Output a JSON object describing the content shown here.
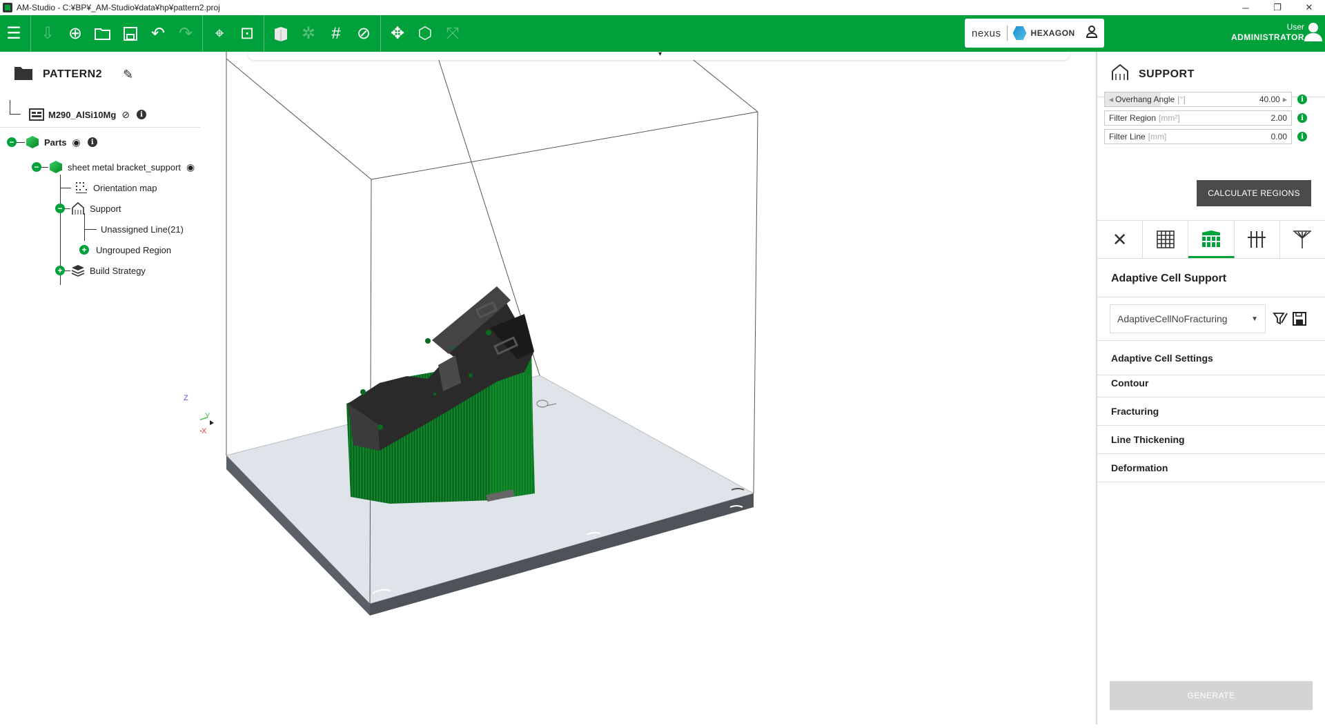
{
  "window": {
    "title": "AM-Studio - C:¥BP¥_AM-Studio¥data¥hp¥pattern2.proj",
    "minimize": "─",
    "restore": "❐",
    "close": "✕"
  },
  "brand": {
    "nexus": "nexus",
    "hexagon": "HEXAGON"
  },
  "user": {
    "label": "User",
    "name": "ADMINISTRATOR"
  },
  "colors": {
    "accent": "#00a13a",
    "support_green": "#0a6b1e",
    "part_black": "#2a2a2a",
    "plate": "#dfe3ea",
    "plate_side": "#4e5359"
  },
  "project": {
    "title": "PATTERN2"
  },
  "tree": {
    "machine": "M290_AlSi10Mg",
    "parts": "Parts",
    "part": "sheet metal bracket_support",
    "orientation": "Orientation map",
    "support": "Support",
    "unassigned": "Unassigned Line(21)",
    "ungrouped": "Ungrouped Region",
    "build_strategy": "Build Strategy"
  },
  "axes": {
    "z": "Z",
    "y": "Y",
    "x": "X"
  },
  "panel": {
    "title": "SUPPORT",
    "params": [
      {
        "label": "Overhang Angle",
        "unit": "[°]",
        "value": "40.00"
      },
      {
        "label": "Filter Region",
        "unit": "[mm²]",
        "value": "2.00"
      },
      {
        "label": "Filter Line",
        "unit": "[mm]",
        "value": "0.00"
      }
    ],
    "calculate": "CALCULATE REGIONS",
    "tabs": [
      "none",
      "grid",
      "adaptive-cell",
      "line",
      "tree"
    ],
    "section_title": "Adaptive Cell Support",
    "dropdown_value": "AdaptiveCellNoFracturing",
    "accordions": [
      "Adaptive Cell Settings",
      "Contour",
      "Fracturing",
      "Line Thickening",
      "Deformation"
    ],
    "generate": "GENERATE"
  }
}
